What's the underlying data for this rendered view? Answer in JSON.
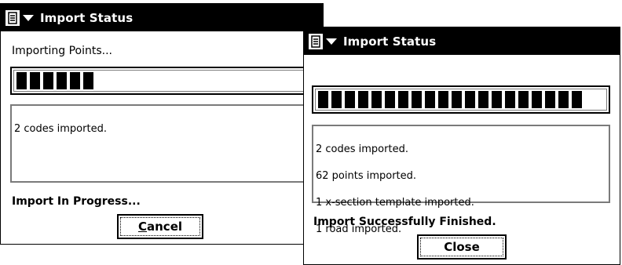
{
  "dialog_in_progress": {
    "title": "Import Status",
    "status": "Importing Points...",
    "progress_fraction": 0.3,
    "progress_segments": 6,
    "log_text": "2 codes imported.",
    "footer": "Import In Progress...",
    "button_label": "Cancel"
  },
  "dialog_finished": {
    "title": "Import Status",
    "progress_fraction": 1.0,
    "progress_segments": 20,
    "log_lines": [
      "2 codes imported.",
      "62 points imported.",
      "1 x-section template imported.",
      "1 road imported."
    ],
    "footer": "Import Successfully Finished.",
    "button_label": "Close"
  },
  "icons": [
    "window-menu-icon",
    "dropdown-arrow-icon"
  ],
  "colors": {
    "titlebar_bg": "#000000",
    "titlebar_text": "#ffffff",
    "window_bg": "#ffffff",
    "inset_border": "#7a7a7a"
  }
}
